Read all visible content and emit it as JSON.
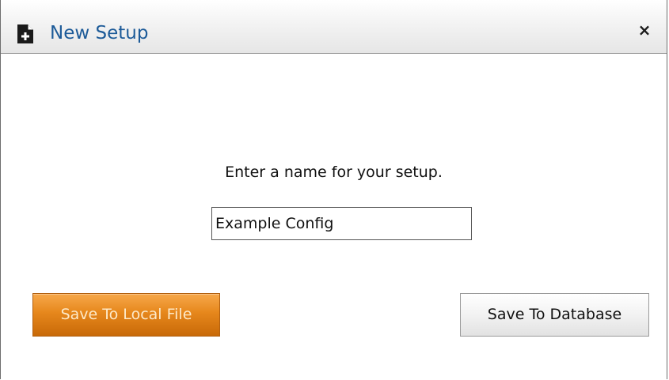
{
  "window": {
    "title": "New Setup",
    "icon": "new-document-icon",
    "close_glyph": "×"
  },
  "form": {
    "prompt": "Enter a name for your setup.",
    "name_value": "Example Config"
  },
  "buttons": {
    "save_local_label": "Save To Local File",
    "save_db_label": "Save To Database"
  },
  "colors": {
    "title_text": "#1c5a98",
    "primary_button": "#e6871c",
    "primary_button_text": "#fde9c8"
  }
}
